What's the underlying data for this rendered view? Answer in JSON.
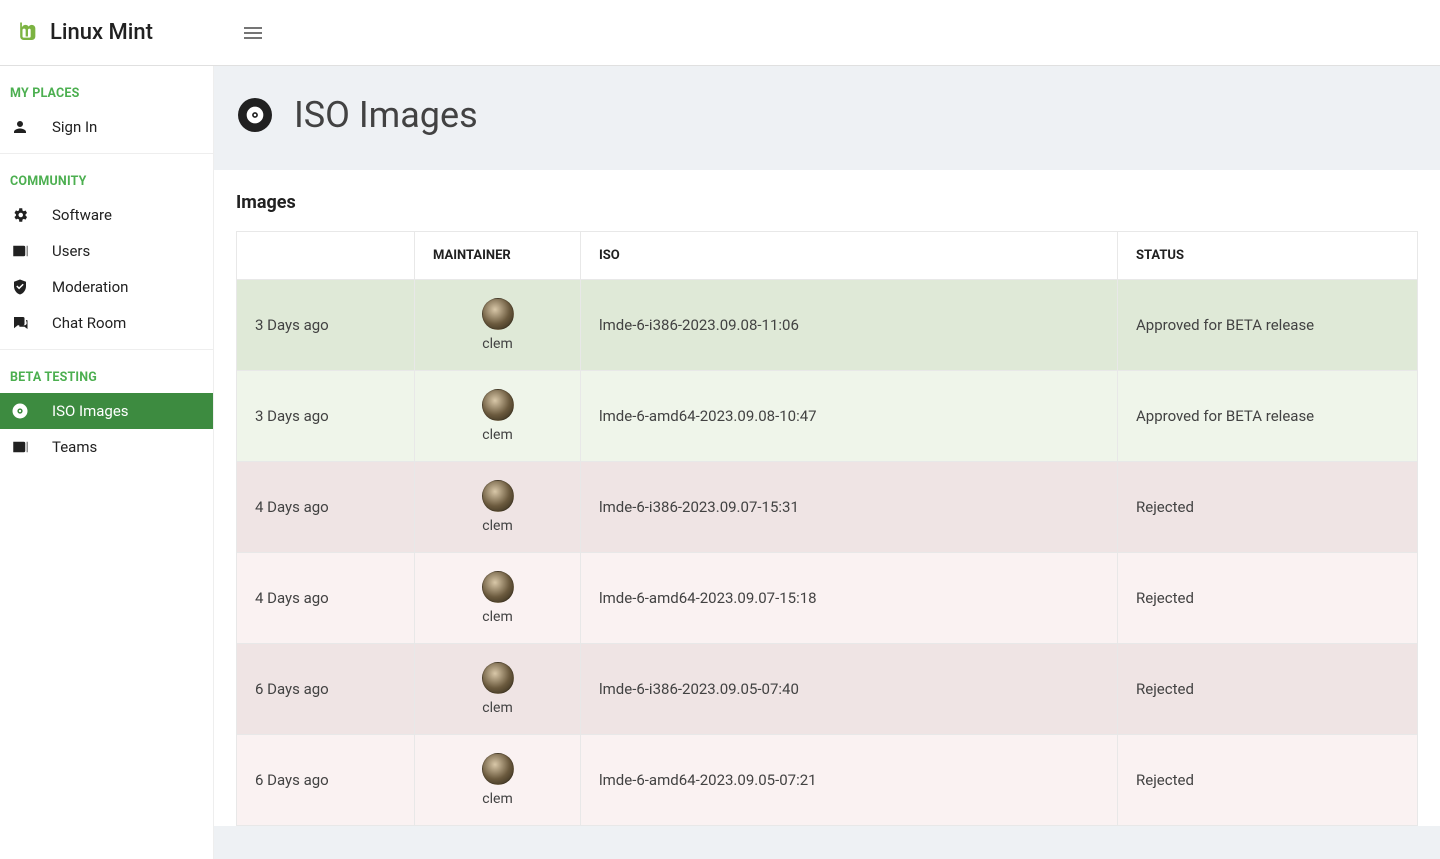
{
  "brand": "Linux Mint",
  "page": {
    "title": "ISO Images",
    "card_title": "Images"
  },
  "sidebar": {
    "sections": [
      {
        "label": "MY PLACES",
        "items": [
          {
            "label": "Sign In",
            "icon": "person-icon"
          }
        ]
      },
      {
        "label": "COMMUNITY",
        "items": [
          {
            "label": "Software",
            "icon": "gears-icon"
          },
          {
            "label": "Users",
            "icon": "contacts-icon"
          },
          {
            "label": "Moderation",
            "icon": "shield-check-icon"
          },
          {
            "label": "Chat Room",
            "icon": "chat-icon"
          }
        ]
      },
      {
        "label": "BETA TESTING",
        "items": [
          {
            "label": "ISO Images",
            "icon": "disc-icon",
            "active": true
          },
          {
            "label": "Teams",
            "icon": "contacts-icon"
          }
        ]
      }
    ]
  },
  "table": {
    "headers": {
      "age": "",
      "maintainer": "MAINTAINER",
      "iso": "ISO",
      "status": "STATUS"
    },
    "rows": [
      {
        "age": "3 Days ago",
        "maintainer": "clem",
        "iso": "lmde-6-i386-2023.09.08-11:06",
        "status": "Approved for BETA release",
        "status_kind": "approved",
        "shade": "dark"
      },
      {
        "age": "3 Days ago",
        "maintainer": "clem",
        "iso": "lmde-6-amd64-2023.09.08-10:47",
        "status": "Approved for BETA release",
        "status_kind": "approved",
        "shade": "light"
      },
      {
        "age": "4 Days ago",
        "maintainer": "clem",
        "iso": "lmde-6-i386-2023.09.07-15:31",
        "status": "Rejected",
        "status_kind": "rejected",
        "shade": "dark"
      },
      {
        "age": "4 Days ago",
        "maintainer": "clem",
        "iso": "lmde-6-amd64-2023.09.07-15:18",
        "status": "Rejected",
        "status_kind": "rejected",
        "shade": "light"
      },
      {
        "age": "6 Days ago",
        "maintainer": "clem",
        "iso": "lmde-6-i386-2023.09.05-07:40",
        "status": "Rejected",
        "status_kind": "rejected",
        "shade": "dark"
      },
      {
        "age": "6 Days ago",
        "maintainer": "clem",
        "iso": "lmde-6-amd64-2023.09.05-07:21",
        "status": "Rejected",
        "status_kind": "rejected",
        "shade": "light"
      }
    ]
  }
}
